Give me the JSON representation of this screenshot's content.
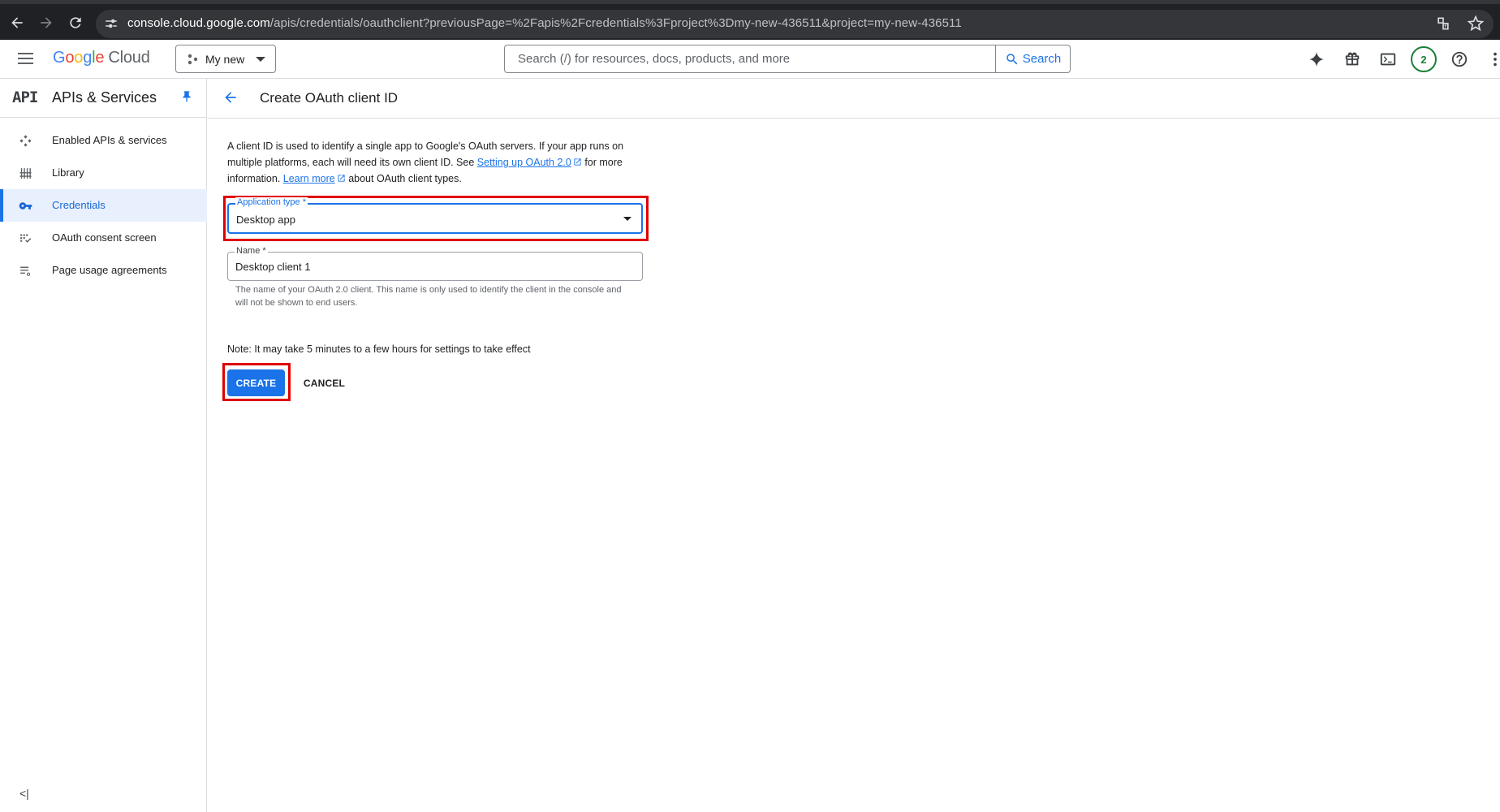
{
  "browser": {
    "url_host": "console.cloud.google.com",
    "url_rest": "/apis/credentials/oauthclient?previousPage=%2Fapis%2Fcredentials%3Fproject%3Dmy-new-436511&project=my-new-436511"
  },
  "header": {
    "logo_google": [
      "G",
      "o",
      "o",
      "g",
      "l",
      "e"
    ],
    "logo_cloud": "Cloud",
    "project": "My new",
    "search_placeholder": "Search (/) for resources, docs, products, and more",
    "search_button": "Search",
    "notification_count": "2",
    "icons": [
      "menu-icon",
      "gemini-icon",
      "gift-icon",
      "terminal-icon",
      "help-icon",
      "more-vert-icon"
    ]
  },
  "sidebar": {
    "logo": "API",
    "title": "APIs & Services",
    "items": [
      {
        "label": "Enabled APIs & services",
        "icon": "enabled-apis-icon",
        "active": false
      },
      {
        "label": "Library",
        "icon": "library-icon",
        "active": false
      },
      {
        "label": "Credentials",
        "icon": "key-icon",
        "active": true
      },
      {
        "label": "OAuth consent screen",
        "icon": "consent-screen-icon",
        "active": false
      },
      {
        "label": "Page usage agreements",
        "icon": "agreements-icon",
        "active": false
      }
    ],
    "collapse": "<|"
  },
  "main": {
    "title": "Create OAuth client ID",
    "intro": {
      "part1": "A client ID is used to identify a single app to Google's OAuth servers. If your app runs on multiple platforms, each will need its own client ID. See ",
      "link1": "Setting up OAuth 2.0",
      "part2": " for more information. ",
      "link2": "Learn more",
      "part3": " about OAuth client types."
    },
    "app_type": {
      "label": "Application type *",
      "value": "Desktop app"
    },
    "name_field": {
      "label": "Name *",
      "value": "Desktop client 1"
    },
    "name_helper": "The name of your OAuth 2.0 client. This name is only used to identify the client in the console and will not be shown to end users.",
    "note": "Note: It may take 5 minutes to a few hours for settings to take effect",
    "create_label": "CREATE",
    "cancel_label": "CANCEL"
  },
  "colors": {
    "accent": "#1a73e8",
    "highlight": "#e00000",
    "browser_bg": "#202124"
  }
}
